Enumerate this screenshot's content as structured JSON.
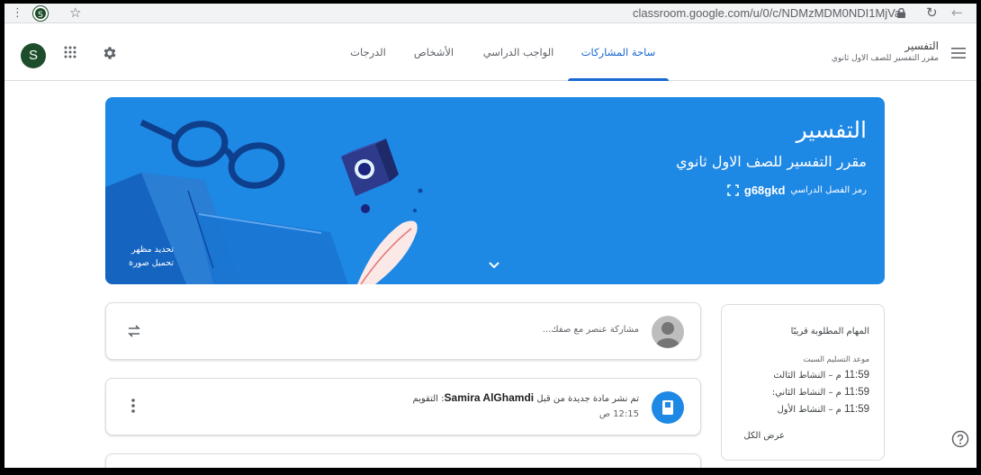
{
  "browser": {
    "menu_glyph": "⋮",
    "profile_letter": "S",
    "url": "classroom.google.com/u/0/c/NDMzMDM0NDI1MjVa",
    "icons": [
      "star-icon",
      "lock-icon",
      "reload-icon",
      "back-icon"
    ]
  },
  "header": {
    "avatar_letter": "S",
    "tabs": [
      {
        "label": "ساحة المشاركات",
        "active": true
      },
      {
        "label": "الواجب الدراسي",
        "active": false
      },
      {
        "label": "الأشخاص",
        "active": false
      },
      {
        "label": "الدرجات",
        "active": false
      }
    ],
    "class_name": "التفسير",
    "class_section": "مقرر التفسير للصف الاول ثانوي",
    "icons": [
      "apps-icon",
      "gear-icon",
      "hamburger-icon"
    ]
  },
  "banner": {
    "title": "التفسير",
    "subtitle": "مقرر التفسير للصف الاول ثانوي",
    "code_label": "رمز الفصل الدراسي",
    "code_value": "g68gkd",
    "customize_line1": "تحديد مظهر",
    "customize_line2": "تحميل صورة",
    "color": "#1e88e5"
  },
  "stream": {
    "share_placeholder": "مشاركة عنصر مع صفك...",
    "post": {
      "prefix": "تم نشر مادة جديدة من قبل",
      "author": "Samira AlGhamdi",
      "material": ": التقويم",
      "time": "12:15 ص"
    }
  },
  "upcoming": {
    "title": "المهام المطلوبة قريبًا",
    "due_label": "موعد التسليم السبت",
    "items": [
      {
        "time": "11:59",
        "text": "م – النشاط الثالث"
      },
      {
        "time": "11:59",
        "text": "م – النشاط الثاني:"
      },
      {
        "time": "11:59",
        "text": "م – النشاط الأول"
      }
    ],
    "view_all": "عرض الكل"
  },
  "accent_color": "#1967d2"
}
